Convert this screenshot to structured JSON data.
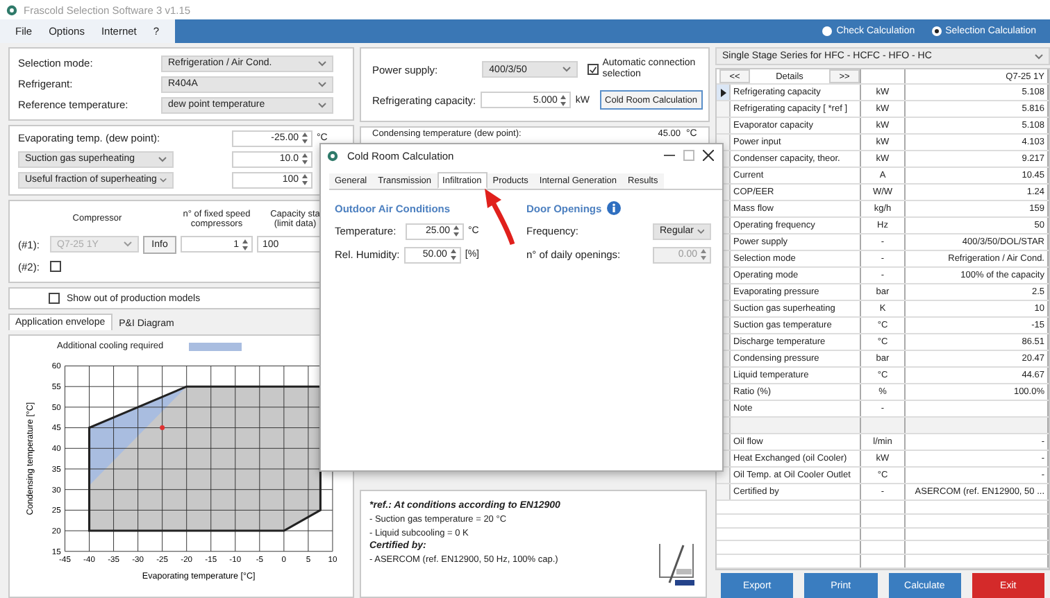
{
  "window": {
    "title": "Frascold Selection Software 3 v1.15"
  },
  "menu": [
    {
      "label": "File"
    },
    {
      "label": "Options"
    },
    {
      "label": "Internet"
    },
    {
      "label": "?"
    }
  ],
  "calculation_modes": [
    {
      "label": "Check Calculation",
      "selected": false
    },
    {
      "label": "Selection Calculation",
      "selected": true
    }
  ],
  "selection": [
    {
      "label": "Selection mode:",
      "value": "Refrigeration / Air Cond."
    },
    {
      "label": "Refrigerant:",
      "value": "R404A"
    },
    {
      "label": "Reference temperature:",
      "value": "dew point temperature"
    }
  ],
  "temperatures": [
    {
      "kind": "label",
      "label": "Evaporating temp. (dew point):",
      "value": "-25.00",
      "unit": "°C"
    },
    {
      "kind": "dropdown",
      "label": "Suction gas superheating",
      "value": "10.0"
    },
    {
      "kind": "dropdown",
      "label": "Useful fraction of superheating",
      "value": "100"
    }
  ],
  "compressors": {
    "columns": [
      "Compressor",
      "n° of fixed speed\ncompressors",
      "Capacity sta\n(limit data)"
    ],
    "rows": [
      {
        "kind": "select",
        "label": "(#1):",
        "model": "Q7-25 1Y",
        "disabled": true,
        "button": "Info",
        "count": "1",
        "capacity": "100"
      },
      {
        "kind": "checkbox",
        "label": "(#2):",
        "checked": false
      }
    ]
  },
  "show_out_of_production": {
    "label": "Show out of production models",
    "checked": false
  },
  "envelope_tabs": [
    {
      "label": "Application envelope",
      "selected": true
    },
    {
      "label": "P&I Diagram",
      "selected": false
    }
  ],
  "envelope": {
    "chart_data": {
      "type": "area",
      "xlabel": "Evaporating temperature [°C]",
      "ylabel": "Condensing temperature [°C]",
      "x": [
        -40,
        -40,
        -40,
        -20,
        7.5,
        7.5,
        0
      ],
      "series": [
        {
          "color": "#c8c8c8",
          "values": [
            20,
            31,
            45,
            55,
            55,
            25,
            20
          ]
        },
        {
          "name": "Additional cooling required",
          "color": "#a9bde0",
          "values": [
            null,
            31,
            45,
            55,
            null,
            null,
            null
          ]
        }
      ],
      "xlim": [
        -45,
        10
      ],
      "ylim": [
        15,
        60
      ],
      "xticks": [
        -45,
        -40,
        -35,
        -30,
        -25,
        -20,
        -15,
        -10,
        -5,
        0,
        5,
        10
      ],
      "yticks": [
        15,
        20,
        25,
        30,
        35,
        40,
        45,
        50,
        55,
        60
      ],
      "grid": true
    }
  },
  "power": {
    "label": "Power supply:",
    "value": "400/3/50",
    "auto_connection": {
      "label": "Automatic connection selection",
      "checked": true
    },
    "capacity_label": "Refrigerating capacity:",
    "capacity": "5.000",
    "capacity_unit": "kW",
    "button": "Cold Room Calculation"
  },
  "condensing": {
    "label": "Condensing temperature (dew point):",
    "value": "45.00",
    "unit": "°C"
  },
  "reference_note": [
    {
      "kind": "heading",
      "text": "*ref.: At conditions according to EN12900"
    },
    {
      "kind": "item",
      "text": "- Suction gas temperature = 20 °C"
    },
    {
      "kind": "item",
      "text": "- Liquid subcooling = 0 K"
    },
    {
      "kind": "heading",
      "text": "Certified by:"
    },
    {
      "kind": "item",
      "text": "- ASERCOM (ref. EN12900, 50 Hz, 100% cap.)"
    }
  ],
  "dialog": {
    "title": "Cold Room Calculation",
    "tabs": [
      {
        "label": "General",
        "selected": false
      },
      {
        "label": "Transmission",
        "selected": false
      },
      {
        "label": "Infiltration",
        "selected": true
      },
      {
        "label": "Products",
        "selected": false
      },
      {
        "label": "Internal Generation",
        "selected": false
      },
      {
        "label": "Results",
        "selected": false
      }
    ],
    "outdoor": {
      "title": "Outdoor Air Conditions",
      "fields": [
        {
          "label": "Temperature:",
          "value": "25.00",
          "unit": "°C"
        },
        {
          "label": "Rel. Humidity:",
          "value": "50.00",
          "unit": "[%]"
        }
      ]
    },
    "doors": {
      "title": "Door Openings",
      "frequency_label": "Frequency:",
      "frequency": "Regular",
      "openings_label": "n° of daily openings:",
      "openings": "0.00",
      "openings_disabled": true
    }
  },
  "series_selector": {
    "value": "Single Stage Series for HFC - HCFC - HFO - HC"
  },
  "results": {
    "header": {
      "prev": "<<",
      "title": "Details",
      "next": ">>",
      "model": "Q7-25 1Y"
    },
    "rows": [
      {
        "name": "Refrigerating capacity",
        "unit": "kW",
        "value": "5.108",
        "selected": true
      },
      {
        "name": "Refrigerating capacity [ *ref ]",
        "unit": "kW",
        "value": "5.816",
        "selected": false
      },
      {
        "name": "Evaporator capacity",
        "unit": "kW",
        "value": "5.108",
        "selected": false
      },
      {
        "name": "Power input",
        "unit": "kW",
        "value": "4.103",
        "selected": false
      },
      {
        "name": "Condenser capacity, theor.",
        "unit": "kW",
        "value": "9.217",
        "selected": false
      },
      {
        "name": "Current",
        "unit": "A",
        "value": "10.45",
        "selected": false
      },
      {
        "name": "COP/EER",
        "unit": "W/W",
        "value": "1.24",
        "selected": false
      },
      {
        "name": "Mass flow",
        "unit": "kg/h",
        "value": "159",
        "selected": false
      },
      {
        "name": "Operating frequency",
        "unit": "Hz",
        "value": "50",
        "selected": false
      },
      {
        "name": "Power supply",
        "unit": "-",
        "value": "400/3/50/DOL/STAR",
        "selected": false
      },
      {
        "name": "Selection mode",
        "unit": "-",
        "value": "Refrigeration / Air Cond.",
        "selected": false
      },
      {
        "name": "Operating mode",
        "unit": "-",
        "value": "100% of the capacity",
        "selected": false
      },
      {
        "name": "Evaporating pressure",
        "unit": "bar",
        "value": "2.5",
        "selected": false
      },
      {
        "name": "Suction gas superheating",
        "unit": "K",
        "value": "10",
        "selected": false
      },
      {
        "name": "Suction gas temperature",
        "unit": "°C",
        "value": "-15",
        "selected": false
      },
      {
        "name": "Discharge temperature",
        "unit": "°C",
        "value": "86.51",
        "selected": false
      },
      {
        "name": "Condensing pressure",
        "unit": "bar",
        "value": "20.47",
        "selected": false
      },
      {
        "name": "Liquid temperature",
        "unit": "°C",
        "value": "44.67",
        "selected": false
      },
      {
        "name": "Ratio (%)",
        "unit": "%",
        "value": "100.0%",
        "selected": false
      },
      {
        "name": "Note",
        "unit": "-",
        "selected": false
      },
      {
        "kind": "blank",
        "selected": false
      },
      {
        "name": "Oil flow",
        "unit": "l/min",
        "value": "-",
        "selected": false
      },
      {
        "name": "Heat Exchanged (oil Cooler)",
        "unit": "kW",
        "value": "-",
        "selected": false
      },
      {
        "name": "Oil Temp. at Oil Cooler Outlet",
        "unit": "°C",
        "value": "-",
        "selected": false
      },
      {
        "name": "Certified by",
        "unit": "-",
        "value": "ASERCOM (ref. EN12900, 50 ...",
        "selected": false
      }
    ]
  },
  "buttons": [
    {
      "kind": "normal",
      "label": "Export"
    },
    {
      "kind": "normal",
      "label": "Print"
    },
    {
      "kind": "normal",
      "label": "Calculate"
    },
    {
      "kind": "danger",
      "label": "Exit"
    }
  ]
}
